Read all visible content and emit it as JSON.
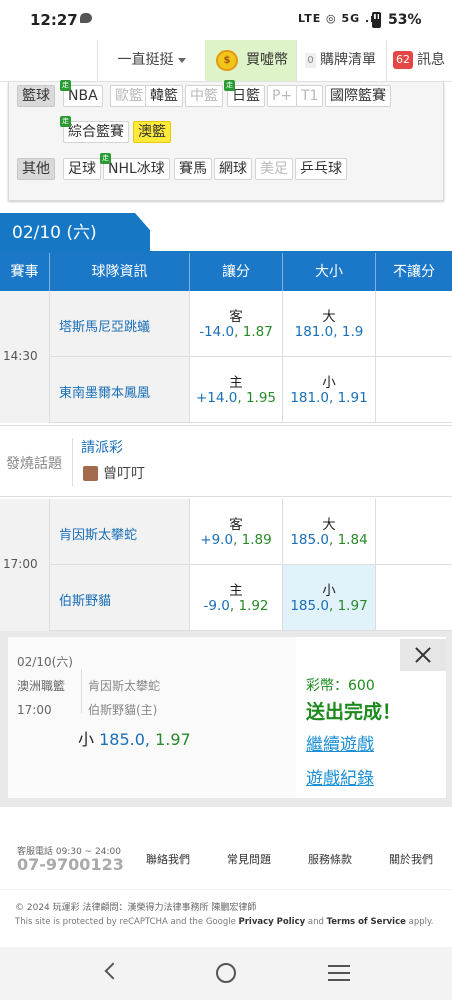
{
  "status_bar": {
    "time": "12:27",
    "signal_text": "LTE ◎ 5G .ıl",
    "battery": "53%"
  },
  "top_nav": {
    "dropdown": "一直挺挺",
    "buy_coin": "買噓幣",
    "cart_count": "0",
    "cart_label": "購牌清單",
    "msg_count": "62",
    "msg_label": "訊息"
  },
  "filter": {
    "basketball_cat": "籃球",
    "basketball": [
      {
        "label": "NBA",
        "live": "走",
        "disabled": false
      },
      {
        "label": "歐籃",
        "disabled": true
      },
      {
        "label": "韓籃",
        "disabled": false
      },
      {
        "label": "中籃",
        "disabled": true
      },
      {
        "label": "日籃",
        "live": "走",
        "disabled": false
      },
      {
        "label": "P+",
        "disabled": true
      },
      {
        "label": "T1",
        "disabled": true
      },
      {
        "label": "國際籃賽",
        "disabled": false
      },
      {
        "label": "綜合籃賽",
        "live": "走",
        "disabled": false
      },
      {
        "label": "澳籃",
        "selected": true
      }
    ],
    "other_cat": "其他",
    "other": [
      {
        "label": "足球",
        "disabled": false
      },
      {
        "label": "NHL冰球",
        "live": "走",
        "disabled": false
      },
      {
        "label": "賽馬",
        "disabled": false
      },
      {
        "label": "網球",
        "disabled": false
      },
      {
        "label": "美足",
        "disabled": true
      },
      {
        "label": "乒乓球",
        "disabled": false
      }
    ]
  },
  "date_tab": "02/10 (六)",
  "table_header": {
    "event": "賽事",
    "teams": "球隊資訊",
    "spread": "讓分",
    "total": "大小",
    "nospread": "不讓分"
  },
  "games": [
    {
      "time": "14:30",
      "away": {
        "team": "塔斯馬尼亞跳蟻",
        "spread_side": "客",
        "spread_line": "-14.0",
        "spread_odds": "1.87",
        "total_side": "大",
        "total_line": "181.0",
        "total_odds": "1.9"
      },
      "home": {
        "team": "東南墨爾本鳳凰",
        "spread_side": "主",
        "spread_line": "+14.0",
        "spread_odds": "1.95",
        "total_side": "小",
        "total_line": "181.0",
        "total_odds": "1.91"
      }
    },
    {
      "time": "17:00",
      "away": {
        "team": "肯因斯太攀蛇",
        "spread_side": "客",
        "spread_line": "+9.0",
        "spread_odds": "1.89",
        "total_side": "大",
        "total_line": "185.0",
        "total_odds": "1.84"
      },
      "home": {
        "team": "伯斯野貓",
        "spread_side": "主",
        "spread_line": "-9.0",
        "spread_odds": "1.92",
        "total_side": "小",
        "total_line": "185.0",
        "total_odds": "1.97"
      }
    }
  ],
  "hot_topic": {
    "label": "發燒話題",
    "link": "請派彩",
    "user": "曾叮叮"
  },
  "bet_slip": {
    "date": "02/10(六)",
    "league": "澳洲職籃",
    "time": "17:00",
    "team1": "肯因斯太攀蛇",
    "team2": "伯斯野貓(主)",
    "pick_side": "小",
    "pick_line": "185.0,",
    "pick_odds": "1.97",
    "coins": "彩幣：600",
    "sent": "送出完成！",
    "continue": "繼續遊戲",
    "history": "遊戲紀錄"
  },
  "footer": {
    "service_label": "客服電話 09:30 ~ 24:00",
    "phone": "07-9700123",
    "links": [
      "聯絡我們",
      "常見問題",
      "服務條款",
      "關於我們"
    ],
    "copyright": "© 2024 玩運彩 法律顧問：漢榮得力法律事務所 陳鵬宏律師",
    "captcha_pre": "This site is protected by reCAPTCHA and the Google ",
    "privacy": "Privacy Policy",
    "and": " and ",
    "terms": "Terms of Service",
    "apply": " apply."
  },
  "colors": {
    "primary_blue": "#1b78c8",
    "odds_green": "#2a8a2a",
    "highlight": "#e1f2fb",
    "selected_tag": "#ffea3a"
  },
  "icons": [
    "chat-bubble-icon",
    "coin-icon",
    "close-icon",
    "back-icon",
    "home-icon",
    "menu-icon"
  ]
}
